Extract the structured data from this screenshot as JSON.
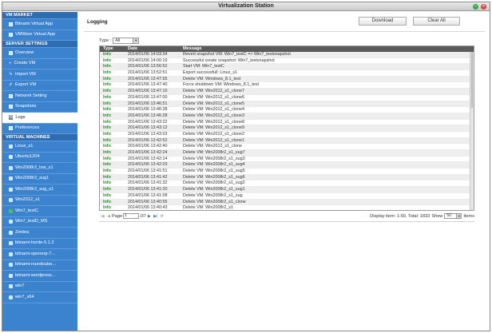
{
  "window": {
    "title": "Virtualization Station"
  },
  "sidebar": {
    "sections": [
      {
        "header": "VM MARKET",
        "items": [
          {
            "label": "Bitnami Virtual App",
            "icon": "app-icon"
          },
          {
            "label": "VMWare Virtual App",
            "icon": "app-icon"
          }
        ]
      },
      {
        "header": "SERVER SETTINGS",
        "items": [
          {
            "label": "Overview",
            "icon": "overview-icon"
          },
          {
            "label": "Create VM",
            "icon": "plus-icon"
          },
          {
            "label": "Import VM",
            "icon": "import-icon"
          },
          {
            "label": "Export VM",
            "icon": "export-icon"
          },
          {
            "label": "Network Setting",
            "icon": "network-icon"
          },
          {
            "label": "Snapshots",
            "icon": "snapshot-icon"
          },
          {
            "label": "Logs",
            "icon": "wrench-icon",
            "active": true
          },
          {
            "label": "Preferences",
            "icon": "preferences-icon"
          }
        ]
      },
      {
        "header": "VIRTUAL MACHINES",
        "items": [
          {
            "label": "Linux_s1",
            "icon": "vm-icon"
          },
          {
            "label": "Ubuntu1204",
            "icon": "vm-icon"
          },
          {
            "label": "Win2008r2_low_s1",
            "icon": "vm-icon"
          },
          {
            "label": "Win2008r2_sug1",
            "icon": "vm-icon"
          },
          {
            "label": "Win2008r2_sug_s1",
            "icon": "vm-icon"
          },
          {
            "label": "Win2012_s1",
            "icon": "vm-icon"
          },
          {
            "label": "Win7_testC",
            "icon": "vm-running-icon",
            "running": true
          },
          {
            "label": "Win7_testD_MS",
            "icon": "vm-icon"
          },
          {
            "label": "Zimbra",
            "icon": "vm-icon"
          },
          {
            "label": "bitnami-horde-5.1.2",
            "icon": "vm-icon"
          },
          {
            "label": "bitnami-openerp-7...",
            "icon": "vm-icon"
          },
          {
            "label": "bitnami-roundcube...",
            "icon": "vm-icon"
          },
          {
            "label": "bitnami-wordpress...",
            "icon": "vm-icon"
          },
          {
            "label": "win7",
            "icon": "vm-icon"
          },
          {
            "label": "win7_x64",
            "icon": "vm-icon"
          }
        ]
      }
    ]
  },
  "main": {
    "title": "Logging",
    "download_label": "Download",
    "clear_label": "Clear All",
    "filter_label": "Type :",
    "filter_value": "All",
    "columns": {
      "type": "Type",
      "date": "Date",
      "message": "Message"
    },
    "rows": [
      {
        "type": "Info",
        "date": "2014/01/06 14:03:34",
        "message": "Revert snapshot VM: Win7_testC => Win7_testsnapshot"
      },
      {
        "type": "Info",
        "date": "2014/01/06 14:00:19",
        "message": "Successful create snapshot: Win7_testsnapshot"
      },
      {
        "type": "Info",
        "date": "2014/01/06 13:56:52",
        "message": "Start VM: Win7_testC"
      },
      {
        "type": "Info",
        "date": "2014/01/06 13:52:51",
        "message": "Export successfull: Linux_s1"
      },
      {
        "type": "Info",
        "date": "2014/01/06 13:47:55",
        "message": "Delete VM: Windows_8.1_test"
      },
      {
        "type": "Info",
        "date": "2014/01/06 13:47:40",
        "message": "Force shutdown VM: Windows_8.1_test"
      },
      {
        "type": "Info",
        "date": "2014/01/06 13:47:10",
        "message": "Delete VM: Win2012_s1_clone7"
      },
      {
        "type": "Info",
        "date": "2014/01/06 13:47:00",
        "message": "Delete VM: Win2012_s1_clone6"
      },
      {
        "type": "Info",
        "date": "2014/01/06 13:46:51",
        "message": "Delete VM: Win2012_s1_clone5"
      },
      {
        "type": "Info",
        "date": "2014/01/06 13:46:38",
        "message": "Delete VM: Win2012_s1_clone4"
      },
      {
        "type": "Info",
        "date": "2014/01/06 13:46:28",
        "message": "Delete VM: Win2012_s1_clone3"
      },
      {
        "type": "Info",
        "date": "2014/01/06 13:43:22",
        "message": "Delete VM: Win2012_s1_clone8"
      },
      {
        "type": "Info",
        "date": "2014/01/06 13:43:12",
        "message": "Delete VM: Win2012_s1_clone9"
      },
      {
        "type": "Info",
        "date": "2014/01/06 13:43:03",
        "message": "Delete VM: Win2012_s1_clone2"
      },
      {
        "type": "Info",
        "date": "2014/01/06 13:42:52",
        "message": "Delete VM: Win2012_s1_clone1"
      },
      {
        "type": "Info",
        "date": "2014/01/06 13:42:40",
        "message": "Delete VM: Win2012_s1_clone"
      },
      {
        "type": "Info",
        "date": "2014/01/06 13:42:24",
        "message": "Delete VM: Win2008r2_s1_sug7"
      },
      {
        "type": "Info",
        "date": "2014/01/06 13:42:14",
        "message": "Delete VM: Win2008r2_s1_sug3"
      },
      {
        "type": "Info",
        "date": "2014/01/06 13:42:03",
        "message": "Delete VM: Win2008r2_s1_sug4"
      },
      {
        "type": "Info",
        "date": "2014/01/06 13:41:51",
        "message": "Delete VM: Win2008r2_s1_sug5"
      },
      {
        "type": "Info",
        "date": "2014/01/06 13:41:42",
        "message": "Delete VM: Win2008r2_s1_sug6"
      },
      {
        "type": "Info",
        "date": "2014/01/06 13:41:32",
        "message": "Delete VM: Win2008r2_s1_sug2"
      },
      {
        "type": "Info",
        "date": "2014/01/06 13:41:20",
        "message": "Delete VM: Win2008r2_s1_sug1"
      },
      {
        "type": "Info",
        "date": "2014/01/06 13:41:08",
        "message": "Delete VM: Win2008r2_s1_sug"
      },
      {
        "type": "Info",
        "date": "2014/01/06 13:40:55",
        "message": "Delete VM: Win2008r2_s1_clone"
      },
      {
        "type": "Info",
        "date": "2014/01/06 13:40:43",
        "message": "Delete VM: Win2008r2_s1"
      }
    ],
    "pager": {
      "page_label": "Page",
      "page_value": "1",
      "total_pages": "/37",
      "display_text": "Display item: 1-50, Total: 1833",
      "show_label": "Show",
      "show_value": "50",
      "items_label": "Items"
    }
  }
}
